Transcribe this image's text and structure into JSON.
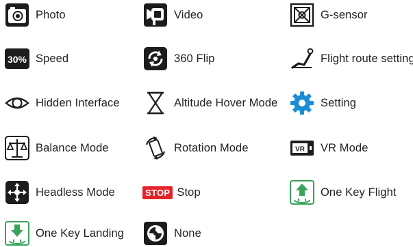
{
  "items": [
    {
      "label": "Photo",
      "icon": "camera-icon"
    },
    {
      "label": "Video",
      "icon": "video-camera-icon"
    },
    {
      "label": "G-sensor",
      "icon": "g-sensor-icon"
    },
    {
      "label": "Speed",
      "icon": "speed-icon",
      "badge": "30%"
    },
    {
      "label": "360 Flip",
      "icon": "flip-360-icon"
    },
    {
      "label": "Flight route setting",
      "icon": "flight-route-icon"
    },
    {
      "label": "Hidden Interface",
      "icon": "eye-icon"
    },
    {
      "label": "Altitude Hover Mode",
      "icon": "hourglass-icon"
    },
    {
      "label": "Setting",
      "icon": "gear-icon"
    },
    {
      "label": "Balance Mode",
      "icon": "balance-icon"
    },
    {
      "label": "Rotation Mode",
      "icon": "rotation-icon"
    },
    {
      "label": "VR Mode",
      "icon": "vr-icon",
      "badge": "VR"
    },
    {
      "label": "Headless Mode",
      "icon": "headless-icon"
    },
    {
      "label": "Stop",
      "icon": "stop-icon",
      "badge": "STOP"
    },
    {
      "label": "One Key Flight",
      "icon": "takeoff-icon"
    },
    {
      "label": "One Key Landing",
      "icon": "landing-icon"
    },
    {
      "label": "None",
      "icon": "none-icon"
    }
  ],
  "colors": {
    "icon_dark": "#1c1c1c",
    "accent_blue": "#1a8fd6",
    "stop_red": "#e5232a",
    "flight_green": "#3aa35a"
  }
}
